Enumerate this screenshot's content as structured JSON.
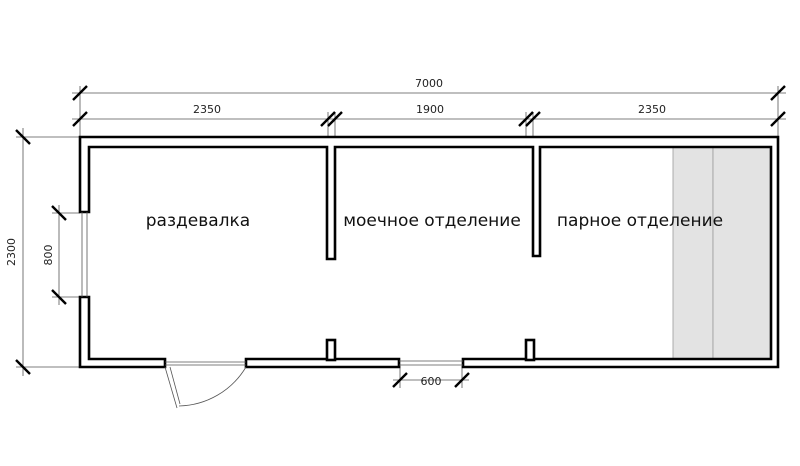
{
  "dimensions": {
    "total_length": "7000",
    "changing_room_length": "2350",
    "washing_room_length": "1900",
    "steam_room_length": "2350",
    "width": "2300",
    "window_width": "800",
    "door_width": "600"
  },
  "rooms": {
    "changing_room": "раздевалка",
    "washing_room": "моечное отделение",
    "steam_room": "парное отделение"
  },
  "colors": {
    "wall": "#000000",
    "dimension_line": "#555555",
    "bench": "#e3e3e3"
  }
}
